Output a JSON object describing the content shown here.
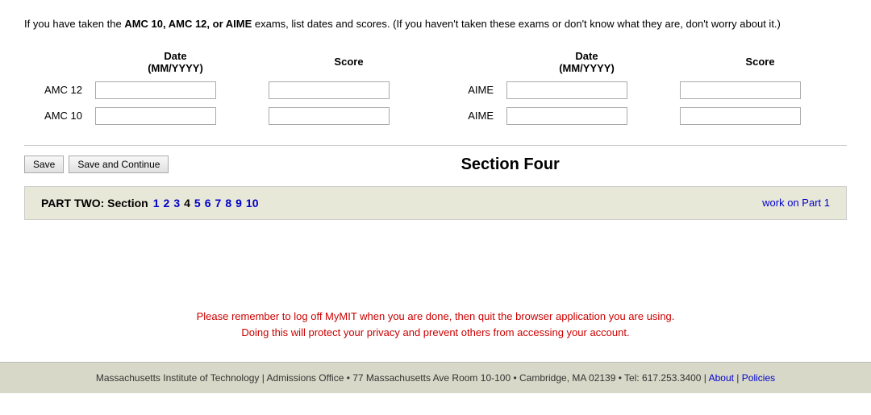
{
  "intro": {
    "text_part1": "If you have taken the ",
    "bold1": "AMC 10, AMC 12, or AIME",
    "text_part2": " exams, list dates and scores. (If you haven't taken these exams or don't know what they are, don't worry about it.)"
  },
  "table": {
    "col1_header_line1": "Date",
    "col1_header_line2": "(MM/YYYY)",
    "col2_header": "Score",
    "col3_header_line1": "Date",
    "col3_header_line2": "(MM/YYYY)",
    "col4_header": "Score",
    "rows": [
      {
        "left_label": "AMC 12",
        "right_label": "AIME"
      },
      {
        "left_label": "AMC 10",
        "right_label": "AIME"
      }
    ]
  },
  "buttons": {
    "save_label": "Save",
    "save_continue_label": "Save and Continue"
  },
  "section_title": "Section Four",
  "nav": {
    "part_two_label": "PART TWO: Section",
    "pages": [
      "1",
      "2",
      "3",
      "4",
      "5",
      "6",
      "7",
      "8",
      "9",
      "10"
    ],
    "plain_pages": [
      "4"
    ],
    "work_on_part_label": "work on Part 1"
  },
  "reminder": {
    "line1": "Please remember to log off MyMIT when you are done, then quit the browser application you are using.",
    "line2": "Doing this will protect your privacy and prevent others from accessing your account."
  },
  "footer": {
    "text": "Massachusetts Institute of Technology | Admissions Office • 77 Massachusetts Ave Room 10-100 • Cambridge, MA 02139 • Tel: 617.253.3400 |",
    "about_label": "About",
    "pipe": "|",
    "policies_label": "Policies"
  }
}
